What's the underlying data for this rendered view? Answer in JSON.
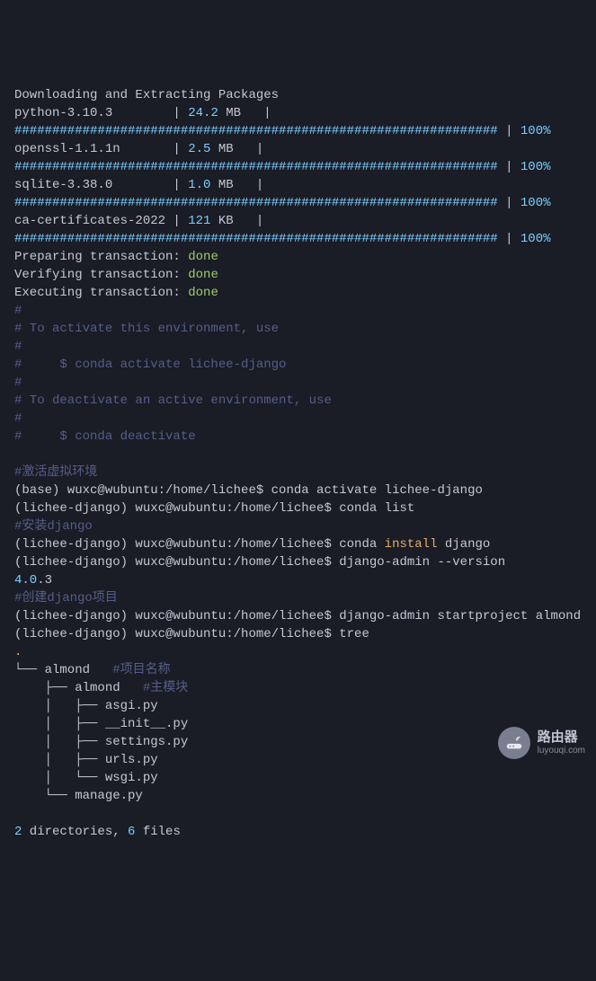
{
  "header": "Downloading and Extracting Packages",
  "packages": [
    {
      "name": "python-3.10.3       ",
      "size_num": "24.2",
      "size_unit": " MB   "
    },
    {
      "name": "openssl-1.1.1n      ",
      "size_num": "2.5",
      "size_unit": " MB   "
    },
    {
      "name": "sqlite-3.38.0       ",
      "size_num": "1.0",
      "size_unit": " MB   "
    },
    {
      "name": "ca-certificates-2022",
      "size_num": "121",
      "size_unit": " KB   "
    }
  ],
  "progress_bar": "################################################################",
  "progress_sep": " | ",
  "progress_pct": "100%",
  "pipe": " | ",
  "transactions": {
    "preparing_label": "Preparing transaction: ",
    "verifying_label": "Verifying transaction: ",
    "executing_label": "Executing transaction: ",
    "done": "done"
  },
  "instructions": [
    "#",
    "# To activate this environment, use",
    "#",
    "#     $ conda activate lichee-django",
    "#",
    "# To deactivate an active environment, use",
    "#",
    "#     $ conda deactivate"
  ],
  "comment_activate": "#激活虚拟环境",
  "lines": {
    "base_activate": "(base) wuxc@wubuntu:/home/lichee$ conda activate lichee-django",
    "conda_list": "(lichee-django) wuxc@wubuntu:/home/lichee$ conda list"
  },
  "comment_install": "#安装django",
  "install_line_prefix": "(lichee-django) wuxc@wubuntu:/home/lichee$ conda ",
  "install_word": "install",
  "install_line_suffix": " django",
  "version_line": "(lichee-django) wuxc@wubuntu:/home/lichee$ django-admin --version",
  "version_num": "4.0",
  "version_rest": ".3",
  "comment_create": "#创建django项目",
  "startproject": "(lichee-django) wuxc@wubuntu:/home/lichee$ django-admin startproject almond",
  "tree_cmd": "(lichee-django) wuxc@wubuntu:/home/lichee$ tree",
  "tree_dot": ".",
  "tree": {
    "l1": "└── almond   ",
    "l1_comment": "#项目名称",
    "l2": "    ├── almond   ",
    "l2_comment": "#主模块",
    "l3": "    │   ├── asgi.py",
    "l4": "    │   ├── __init__.py",
    "l5": "    │   ├── settings.py",
    "l6": "    │   ├── urls.py",
    "l7": "    │   └── wsgi.py",
    "l8": "    └── manage.py"
  },
  "summary": {
    "dirs_num": "2",
    "dirs_label": " directories, ",
    "files_num": "6",
    "files_label": " files"
  },
  "watermark": {
    "cn": "路由器",
    "en": "luyouqi.com"
  }
}
